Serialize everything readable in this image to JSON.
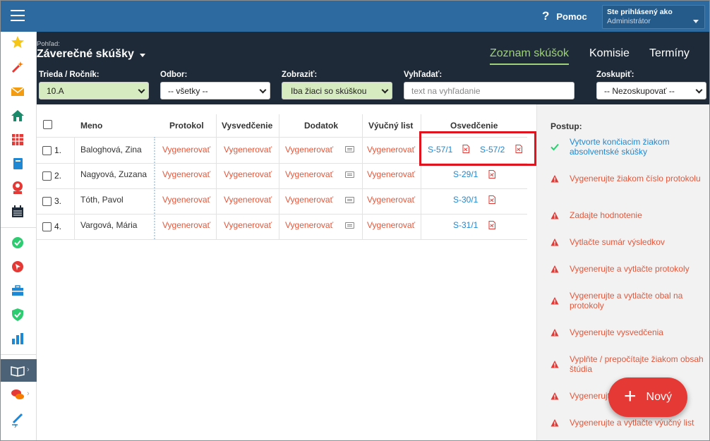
{
  "topbar": {
    "help_label": "Pomoc",
    "user_line1": "Ste prihlásený ako",
    "user_line2": "Administrátor"
  },
  "sidebar": {
    "icons": [
      "star-icon",
      "magic-wand-icon",
      "envelope-icon",
      "home-icon",
      "grid-calendar-icon",
      "notebook-icon",
      "person-icon",
      "calendar-icon",
      "check-circle-icon",
      "pointer-icon",
      "briefcase-icon",
      "shield-icon",
      "bar-chart-icon",
      "book-icon",
      "chat-icon",
      "pen-icon"
    ]
  },
  "header": {
    "view_label": "Pohľad:",
    "title": "Záverečné skúšky",
    "tabs": [
      "Zoznam skúšok",
      "Komisie",
      "Termíny"
    ]
  },
  "filters": {
    "class": {
      "label": "Trieda / Ročník:",
      "value": "10.A"
    },
    "field": {
      "label": "Odbor:",
      "value": "-- všetky --"
    },
    "show": {
      "label": "Zobraziť:",
      "value": "Iba žiaci so skúškou"
    },
    "search": {
      "label": "Vyhľadať:",
      "placeholder": "text na vyhľadanie"
    },
    "group": {
      "label": "Zoskupiť:",
      "value": "-- Nezoskupovať --"
    }
  },
  "table": {
    "headers": [
      "Meno",
      "Protokol",
      "Vysvedčenie",
      "Dodatok",
      "Výučný list",
      "Osvedčenie"
    ],
    "generate_label": "Vygenerovať",
    "rows": [
      {
        "num": "1.",
        "name": "Baloghová, Zina",
        "cert": [
          "S-57/1",
          "S-57/2"
        ]
      },
      {
        "num": "2.",
        "name": "Nagyová, Zuzana",
        "cert": [
          "S-29/1"
        ]
      },
      {
        "num": "3.",
        "name": "Tóth, Pavol",
        "cert": [
          "S-30/1"
        ]
      },
      {
        "num": "4.",
        "name": "Vargová, Mária",
        "cert": [
          "S-31/1"
        ]
      }
    ]
  },
  "panel": {
    "title": "Postup:",
    "steps": [
      {
        "status": "done",
        "text": "Vytvorte končiacim žiakom absolventské skúšky"
      },
      {
        "status": "todo",
        "text": "Vygenerujte žiakom číslo protokolu"
      },
      {
        "status": "todo",
        "text": "Zadajte hodnotenie"
      },
      {
        "status": "todo",
        "text": "Vytlačte sumár výsledkov"
      },
      {
        "status": "todo",
        "text": "Vygenerujte a vytlačte protokoly"
      },
      {
        "status": "todo",
        "text": "Vygenerujte a vytlačte obal na protokoly"
      },
      {
        "status": "todo",
        "text": "Vygenerujte vysvedčenia"
      },
      {
        "status": "todo",
        "text": "Vyplňte / prepočítajte žiakom obsah štúdia"
      },
      {
        "status": "todo",
        "text": "Vygenerujte"
      },
      {
        "status": "todo",
        "text": "Vygenerujte a vytlačte výučný list"
      }
    ]
  },
  "fab": {
    "label": "Nový"
  }
}
